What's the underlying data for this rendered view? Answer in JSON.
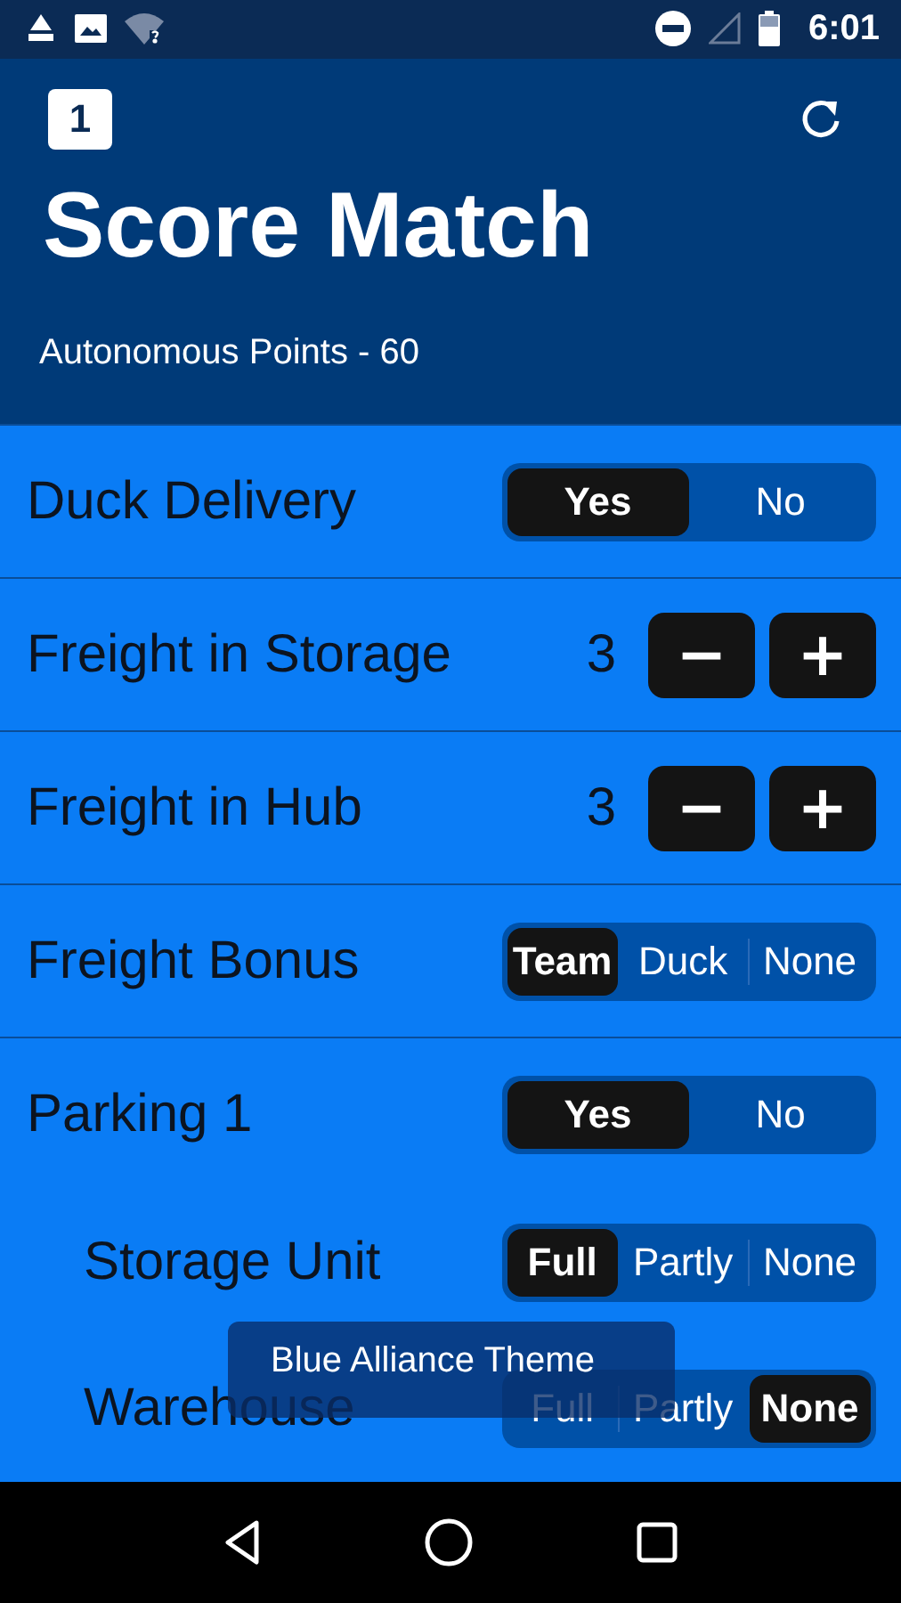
{
  "status_bar": {
    "time": "6:01"
  },
  "header": {
    "badge": "1",
    "title": "Score Match",
    "subtitle": "Autonomous Points - 60"
  },
  "rows": [
    {
      "kind": "toggle",
      "label": "Duck Delivery",
      "options": [
        {
          "label": "Yes",
          "selected": true
        },
        {
          "label": "No",
          "selected": false
        }
      ]
    },
    {
      "kind": "counter",
      "label": "Freight in Storage",
      "value": "3",
      "buttons": [
        "−",
        "+"
      ]
    },
    {
      "kind": "counter",
      "label": "Freight in Hub",
      "value": "3",
      "buttons": [
        "−",
        "+"
      ]
    },
    {
      "kind": "toggle",
      "label": "Freight Bonus",
      "options": [
        {
          "label": "Team",
          "selected": true
        },
        {
          "label": "Duck",
          "selected": false
        },
        {
          "label": "None",
          "selected": false
        }
      ]
    },
    {
      "kind": "toggle",
      "label": "Parking 1",
      "options": [
        {
          "label": "Yes",
          "selected": true
        },
        {
          "label": "No",
          "selected": false
        }
      ],
      "children": [
        {
          "kind": "toggle",
          "label": "Storage Unit",
          "options": [
            {
              "label": "Full",
              "selected": true
            },
            {
              "label": "Partly",
              "selected": false
            },
            {
              "label": "None",
              "selected": false
            }
          ]
        },
        {
          "kind": "toggle",
          "label": "Warehouse",
          "options": [
            {
              "label": "Full",
              "selected": false
            },
            {
              "label": "Partly",
              "selected": false
            },
            {
              "label": "None",
              "selected": true
            }
          ]
        }
      ]
    }
  ],
  "toast": {
    "text": "Blue Alliance Theme"
  }
}
